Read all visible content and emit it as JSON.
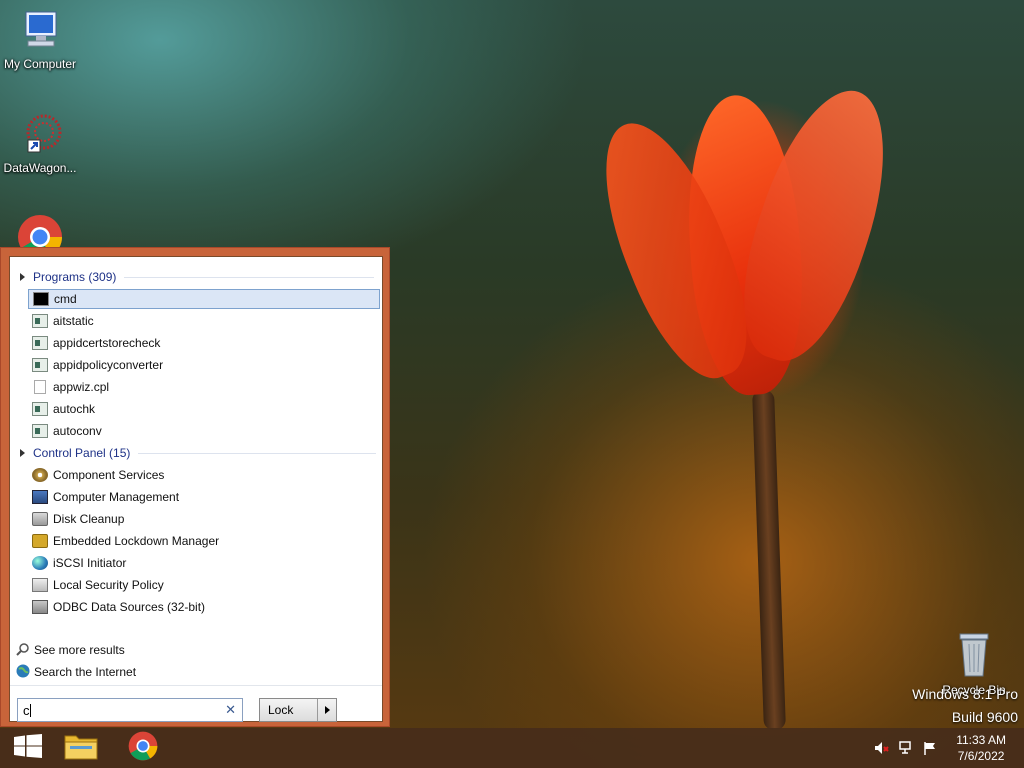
{
  "desktop": {
    "icons": [
      {
        "label": "My Computer",
        "icon": "computer-icon"
      },
      {
        "label": "DataWagon...",
        "icon": "datawagon-shortcut-icon"
      },
      {
        "label": "",
        "icon": "chrome-icon"
      },
      {
        "label": "Recycle Bin",
        "icon": "recycle-bin-icon"
      }
    ],
    "watermark": {
      "line1": "Windows 8.1 Pro",
      "line2": "Build 9600"
    }
  },
  "start_menu": {
    "groups": [
      {
        "title": "Programs (309)",
        "items": [
          {
            "label": "cmd",
            "icon": "cmd-icon"
          },
          {
            "label": "aitstatic",
            "icon": "exe-icon"
          },
          {
            "label": "appidcertstorecheck",
            "icon": "exe-icon"
          },
          {
            "label": "appidpolicyconverter",
            "icon": "exe-icon"
          },
          {
            "label": "appwiz.cpl",
            "icon": "file-icon"
          },
          {
            "label": "autochk",
            "icon": "exe-icon"
          },
          {
            "label": "autoconv",
            "icon": "exe-icon"
          }
        ]
      },
      {
        "title": "Control Panel (15)",
        "items": [
          {
            "label": "Component Services",
            "icon": "component-services-icon"
          },
          {
            "label": "Computer Management",
            "icon": "computer-management-icon"
          },
          {
            "label": "Disk Cleanup",
            "icon": "disk-cleanup-icon"
          },
          {
            "label": "Embedded Lockdown Manager",
            "icon": "lock-icon"
          },
          {
            "label": "iSCSI Initiator",
            "icon": "globe-icon"
          },
          {
            "label": "Local Security Policy",
            "icon": "security-policy-icon"
          },
          {
            "label": "ODBC Data Sources (32-bit)",
            "icon": "odbc-icon"
          }
        ]
      }
    ],
    "see_more": "See more results",
    "search_internet": "Search the Internet",
    "search": {
      "value": "c"
    },
    "lock_label": "Lock"
  },
  "taskbar": {
    "clock": {
      "time": "11:33 AM",
      "date": "7/6/2022"
    }
  }
}
